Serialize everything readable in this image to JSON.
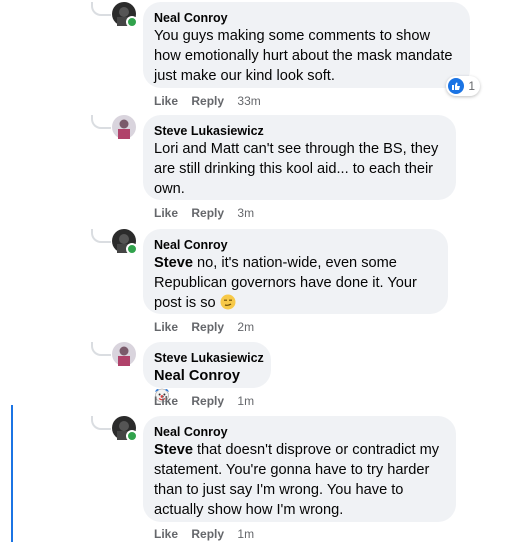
{
  "comments": [
    {
      "author": "Neal Conroy",
      "text": "You guys making some comments to show how emotionally hurt about the mask mandate just make our kind look soft.",
      "like": "Like",
      "reply": "Reply",
      "time": "33m",
      "reaction_count": "1"
    },
    {
      "author": "Steve Lukasiewicz",
      "text": "Lori and Matt can't see through the BS, they are still drinking this kool aid... to each their own.",
      "like": "Like",
      "reply": "Reply",
      "time": "3m"
    },
    {
      "author": "Neal Conroy",
      "mention": "Steve",
      "text": " no, it's nation-wide, even some Republican governors have done it. Your post is so ",
      "emoji": "smirk-face-emoji",
      "like": "Like",
      "reply": "Reply",
      "time": "2m"
    },
    {
      "author": "Steve Lukasiewicz",
      "mention": "Neal Conroy",
      "emoji": "clown-face-emoji",
      "like": "Like",
      "reply": "Reply",
      "time": "1m"
    },
    {
      "author": "Neal Conroy",
      "mention": "Steve",
      "text": " that doesn't disprove or contradict my statement. You're gonna have to try harder than to just say I'm wrong. You have to actually show how I'm wrong.",
      "like": "Like",
      "reply": "Reply",
      "time": "1m"
    }
  ],
  "colors": {
    "bubble": "#f0f2f5",
    "meta": "#65676b",
    "accent": "#1b74e4",
    "online": "#31a24c"
  }
}
